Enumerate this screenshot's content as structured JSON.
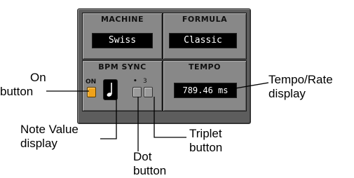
{
  "panel": {
    "machine_label": "MACHINE",
    "formula_label": "FORMULA",
    "machine_value": "Swiss",
    "formula_value": "Classic",
    "bpm_sync_label": "BPM SYNC",
    "tempo_label": "TEMPO",
    "on_label": "ON",
    "dot_glyph": "•",
    "triplet_glyph": "3",
    "tempo_value": "789.46 ms",
    "accent_color": "#f0a21a"
  },
  "callouts": {
    "on_button": [
      "On",
      "button"
    ],
    "tempo_rate": [
      "Tempo/Rate",
      "display"
    ],
    "note_value": [
      "Note Value",
      "display"
    ],
    "triplet": [
      "Triplet",
      "button"
    ],
    "dot": [
      "Dot",
      "button"
    ]
  }
}
